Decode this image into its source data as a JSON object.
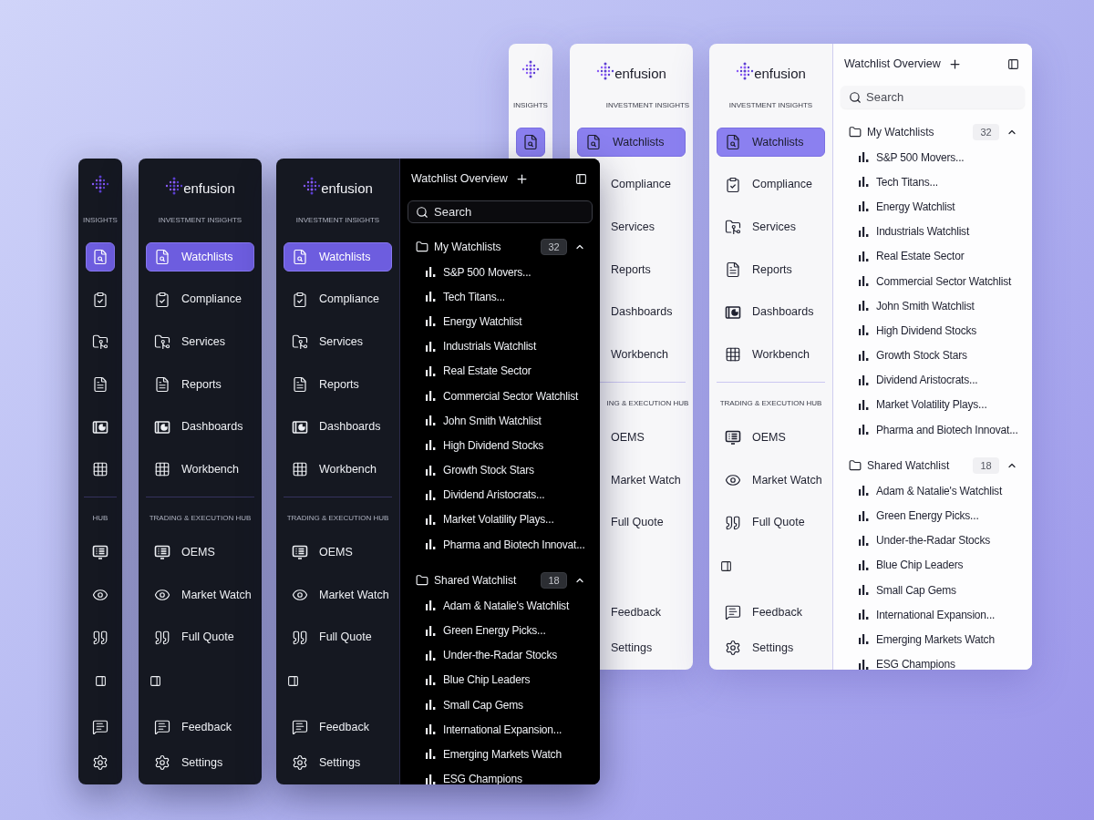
{
  "panels": [
    {
      "kind": "light-rail",
      "sections": [
        {
          "label": "INSIGHTS",
          "items": [
            {
              "kind": "watchlist",
              "selected": true
            }
          ]
        }
      ],
      "collapse_toggle": false
    },
    {
      "kind": "light-sidebar",
      "brand": "enfusion",
      "sections": [
        {
          "label": "INVESTMENT INSIGHTS",
          "items": [
            {
              "label": "Watchlists",
              "kind": "watchlist",
              "selected": true
            },
            {
              "label": "Compliance",
              "selected": false
            },
            {
              "label": "Services",
              "selected": false
            },
            {
              "label": "Reports",
              "selected": false
            },
            {
              "label": "Dashboards",
              "selected": false
            },
            {
              "label": "Workbench",
              "selected": false
            }
          ]
        },
        {
          "label": "ING & EXECUTION HUB",
          "items": [
            {
              "label": "OEMS",
              "selected": false
            },
            {
              "label": "Market Watch",
              "selected": false
            },
            {
              "label": "Full Quote",
              "selected": false
            }
          ]
        }
      ],
      "collapse_toggle": false,
      "footer": [
        {
          "label": "Feedback"
        },
        {
          "label": "Settings"
        }
      ]
    },
    {
      "kind": "light-expanded",
      "brand": "enfusion",
      "sections": [
        {
          "label": "INVESTMENT INSIGHTS",
          "items": [
            {
              "label": "Watchlists",
              "kind": "watchlist",
              "selected": true
            },
            {
              "label": "Compliance",
              "kind": "compliance",
              "selected": false
            },
            {
              "label": "Services",
              "kind": "services",
              "selected": false
            },
            {
              "label": "Reports",
              "kind": "reports",
              "selected": false
            },
            {
              "label": "Dashboards",
              "kind": "dashboards",
              "selected": false
            },
            {
              "label": "Workbench",
              "kind": "workbench",
              "selected": false
            }
          ]
        },
        {
          "label": "TRADING & EXECUTION HUB",
          "items": [
            {
              "label": "OEMS",
              "kind": "oems",
              "selected": false
            },
            {
              "label": "Market Watch",
              "kind": "market_watch",
              "selected": false
            },
            {
              "label": "Full Quote",
              "kind": "full_quote",
              "selected": false
            }
          ]
        }
      ],
      "collapse_toggle": true,
      "footer": [
        {
          "label": "Feedback",
          "kind": "feedback"
        },
        {
          "label": "Settings",
          "kind": "settings"
        }
      ],
      "watchlist_pane": {
        "title": "Watchlist Overview",
        "search": {
          "placeholder": "Search"
        },
        "groups": [
          {
            "label": "My Watchlists",
            "count": "32",
            "expanded": true,
            "items": [
              "S&P 500 Movers...",
              "Tech Titans...",
              "Energy Watchlist",
              "Industrials Watchlist",
              "Real Estate Sector",
              "Commercial Sector Watchlist",
              "John Smith Watchlist",
              "High Dividend Stocks",
              "Growth Stock Stars",
              "Dividend Aristocrats...",
              "Market Volatility Plays...",
              "Pharma and Biotech Innovat..."
            ]
          },
          {
            "label": "Shared Watchlist",
            "count": "18",
            "expanded": true,
            "items": [
              "Adam & Natalie's Watchlist",
              "Green Energy Picks...",
              "Under-the-Radar Stocks",
              "Blue Chip Leaders",
              "Small Cap Gems",
              "International Expansion...",
              "Emerging Markets Watch",
              "ESG Champions"
            ]
          }
        ]
      }
    },
    {
      "kind": "dark-rail",
      "sections": [
        {
          "label": "INSIGHTS",
          "items": [
            {
              "kind": "watchlist",
              "selected": true
            },
            {
              "kind": "compliance",
              "selected": false
            },
            {
              "kind": "services",
              "selected": false
            },
            {
              "kind": "reports",
              "selected": false
            },
            {
              "kind": "dashboards",
              "selected": false
            },
            {
              "kind": "workbench",
              "selected": false
            }
          ]
        },
        {
          "label": "HUB",
          "items": [
            {
              "kind": "oems",
              "selected": false
            },
            {
              "kind": "market_watch",
              "selected": false
            },
            {
              "kind": "full_quote",
              "selected": false
            }
          ]
        }
      ],
      "collapse_toggle": true,
      "footer": [
        {
          "kind": "feedback"
        },
        {
          "kind": "settings"
        }
      ]
    },
    {
      "kind": "dark-sidebar",
      "brand": "enfusion",
      "sections": [
        {
          "label": "INVESTMENT INSIGHTS",
          "items": [
            {
              "label": "Watchlists",
              "kind": "watchlist",
              "selected": true
            },
            {
              "label": "Compliance",
              "kind": "compliance",
              "selected": false
            },
            {
              "label": "Services",
              "kind": "services",
              "selected": false
            },
            {
              "label": "Reports",
              "kind": "reports",
              "selected": false
            },
            {
              "label": "Dashboards",
              "kind": "dashboards",
              "selected": false
            },
            {
              "label": "Workbench",
              "kind": "workbench",
              "selected": false
            }
          ]
        },
        {
          "label": "TRADING & EXECUTION HUB",
          "items": [
            {
              "label": "OEMS",
              "kind": "oems",
              "selected": false
            },
            {
              "label": "Market Watch",
              "kind": "market_watch",
              "selected": false
            },
            {
              "label": "Full Quote",
              "kind": "full_quote",
              "selected": false
            }
          ]
        }
      ],
      "collapse_toggle": true,
      "footer": [
        {
          "label": "Feedback",
          "kind": "feedback"
        },
        {
          "label": "Settings",
          "kind": "settings"
        }
      ]
    },
    {
      "kind": "dark-expanded",
      "brand": "enfusion",
      "sections": [
        {
          "label": "INVESTMENT INSIGHTS",
          "items": [
            {
              "label": "Watchlists",
              "kind": "watchlist",
              "selected": true
            },
            {
              "label": "Compliance",
              "kind": "compliance",
              "selected": false
            },
            {
              "label": "Services",
              "kind": "services",
              "selected": false
            },
            {
              "label": "Reports",
              "kind": "reports",
              "selected": false
            },
            {
              "label": "Dashboards",
              "kind": "dashboards",
              "selected": false
            },
            {
              "label": "Workbench",
              "kind": "workbench",
              "selected": false
            }
          ]
        },
        {
          "label": "TRADING & EXECUTION HUB",
          "items": [
            {
              "label": "OEMS",
              "kind": "oems",
              "selected": false
            },
            {
              "label": "Market Watch",
              "kind": "market_watch",
              "selected": false
            },
            {
              "label": "Full Quote",
              "kind": "full_quote",
              "selected": false
            }
          ]
        }
      ],
      "collapse_toggle": true,
      "footer": [
        {
          "label": "Feedback",
          "kind": "feedback"
        },
        {
          "label": "Settings",
          "kind": "settings"
        }
      ],
      "watchlist_pane": {
        "title": "Watchlist Overview",
        "search": {
          "placeholder": "Search"
        },
        "groups": [
          {
            "label": "My Watchlists",
            "count": "32",
            "expanded": true,
            "items": [
              "S&P 500 Movers...",
              "Tech Titans...",
              "Energy Watchlist",
              "Industrials Watchlist",
              "Real Estate Sector",
              "Commercial Sector Watchlist",
              "John Smith Watchlist",
              "High Dividend Stocks",
              "Growth Stock Stars",
              "Dividend Aristocrats...",
              "Market Volatility Plays...",
              "Pharma and Biotech Innovat..."
            ]
          },
          {
            "label": "Shared Watchlist",
            "count": "18",
            "expanded": true,
            "items": [
              "Adam & Natalie's Watchlist",
              "Green Energy Picks...",
              "Under-the-Radar Stocks",
              "Blue Chip Leaders",
              "Small Cap Gems",
              "International Expansion...",
              "Emerging Markets Watch",
              "ESG Champions"
            ]
          }
        ]
      }
    }
  ]
}
